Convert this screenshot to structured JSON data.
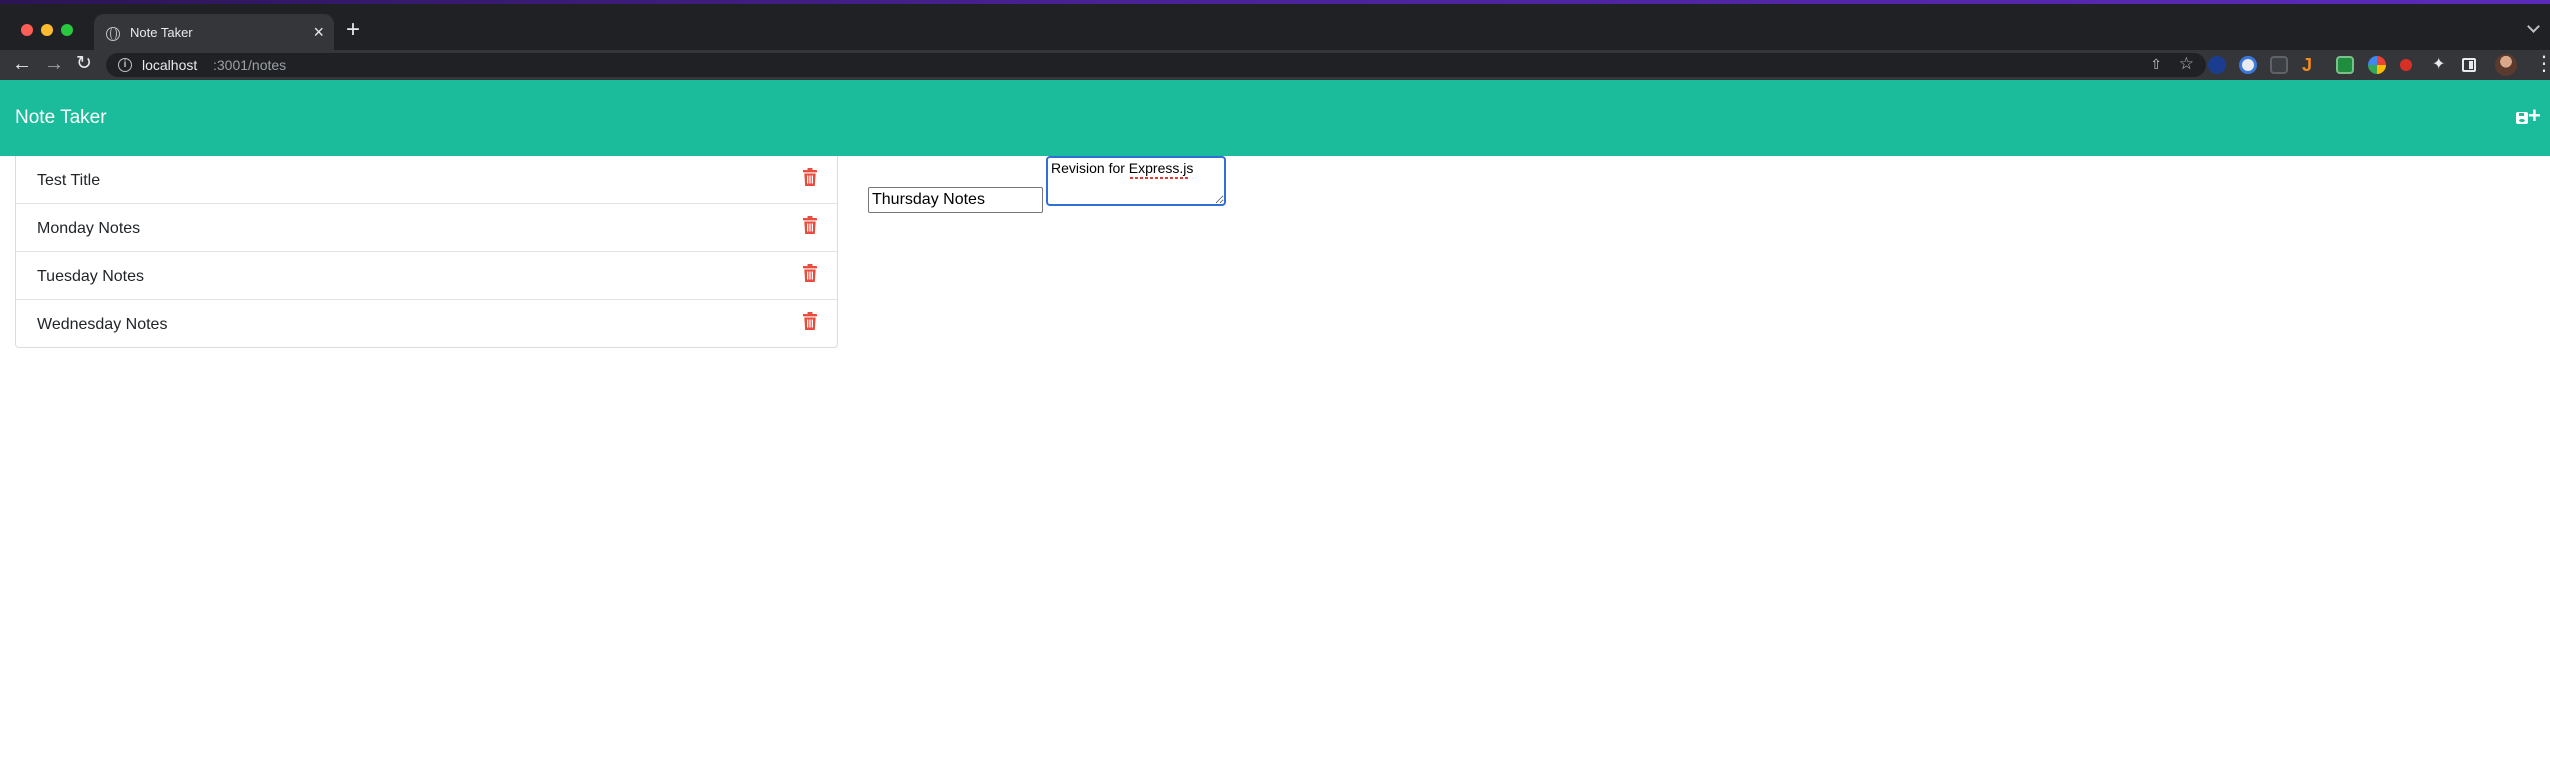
{
  "browser": {
    "tab_title": "Note Taker",
    "tab_close": "×",
    "new_tab": "+",
    "url_host": "localhost",
    "url_path": ":3001/notes",
    "info_glyph": "i",
    "back_glyph": "←",
    "forward_glyph": "→",
    "reload_glyph": "↻",
    "share_glyph": "⇧",
    "star_glyph": "☆",
    "menu_glyph": "⋮",
    "extension_glyph_j": "J",
    "puzzle_glyph": "✦",
    "tab_strip_color": "#202124",
    "toolbar_color": "#35363a"
  },
  "app": {
    "brand": "Note Taker",
    "plus_glyph": "+",
    "accent_color": "#1abc9c",
    "delete_icon_color": "#e74c3c",
    "notes": [
      {
        "title": "Test Title"
      },
      {
        "title": "Monday Notes"
      },
      {
        "title": "Tuesday Notes"
      },
      {
        "title": "Wednesday Notes"
      }
    ],
    "editor": {
      "title_value": "Thursday Notes",
      "text_value": "Revision for Express.js"
    }
  }
}
